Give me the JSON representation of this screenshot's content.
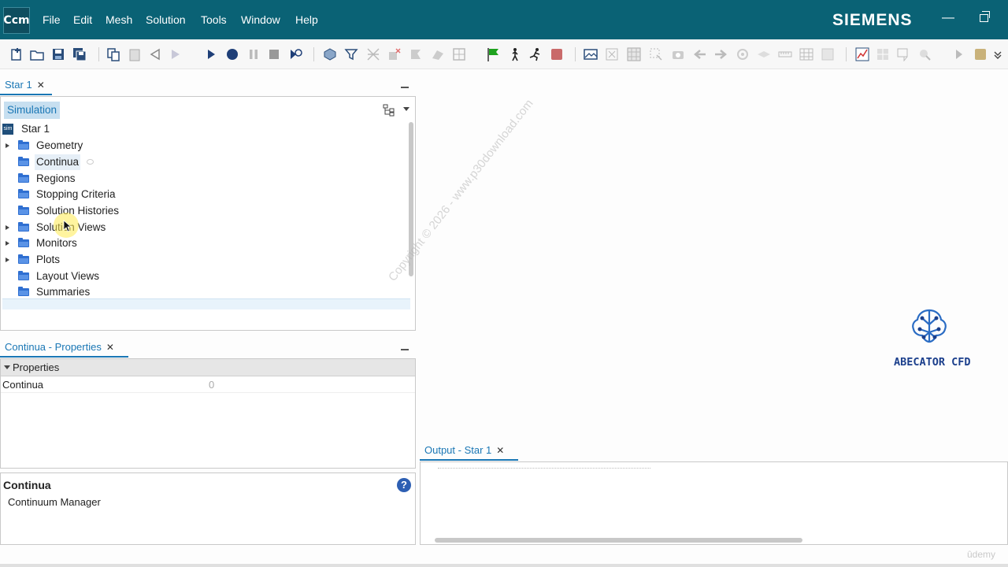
{
  "app": {
    "logo": "Ccm",
    "brand": "SIEMENS"
  },
  "menu": [
    "File",
    "Edit",
    "Mesh",
    "Solution",
    "Tools",
    "Window",
    "Help"
  ],
  "tree_panel": {
    "tab_label": "Star 1",
    "header": "Simulation",
    "root": "Star 1",
    "items": [
      {
        "label": "Geometry",
        "expandable": true
      },
      {
        "label": "Continua",
        "expandable": false,
        "selected": true
      },
      {
        "label": "Regions",
        "expandable": false
      },
      {
        "label": "Stopping Criteria",
        "expandable": false
      },
      {
        "label": "Solution Histories",
        "expandable": false
      },
      {
        "label": "Solution Views",
        "expandable": true
      },
      {
        "label": "Monitors",
        "expandable": true
      },
      {
        "label": "Plots",
        "expandable": true
      },
      {
        "label": "Layout Views",
        "expandable": false
      },
      {
        "label": "Summaries",
        "expandable": false
      }
    ]
  },
  "properties_panel": {
    "tab_label": "Continua - Properties",
    "section": "Properties",
    "row_name": "Continua",
    "row_value": "0"
  },
  "description_panel": {
    "title": "Continua",
    "text": "Continuum Manager"
  },
  "output_panel": {
    "tab_label": "Output - Star 1"
  },
  "watermark": "Copyright © 2026 - www.p30download.com",
  "badge": {
    "text": "ABECATOR CFD"
  },
  "footer": {
    "udemy": "ûdemy"
  },
  "colors": {
    "menubar": "#0a6275",
    "accent": "#1a77b5",
    "folder": "#2f6fd1"
  }
}
